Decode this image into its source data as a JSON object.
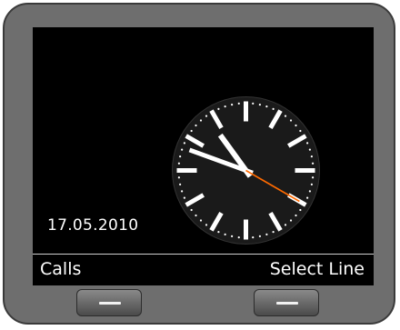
{
  "screen": {
    "date": "17.05.2010"
  },
  "softkeys": {
    "left_label": "Calls",
    "right_label": "Select Line"
  },
  "clock": {
    "time_hours": 10,
    "time_minutes": 48,
    "time_seconds": 20,
    "hand_color": "#ffffff",
    "second_hand_color": "#ff6a00"
  },
  "colors": {
    "bezel": "#6e6e6e",
    "screen": "#000000",
    "text": "#ffffff"
  }
}
